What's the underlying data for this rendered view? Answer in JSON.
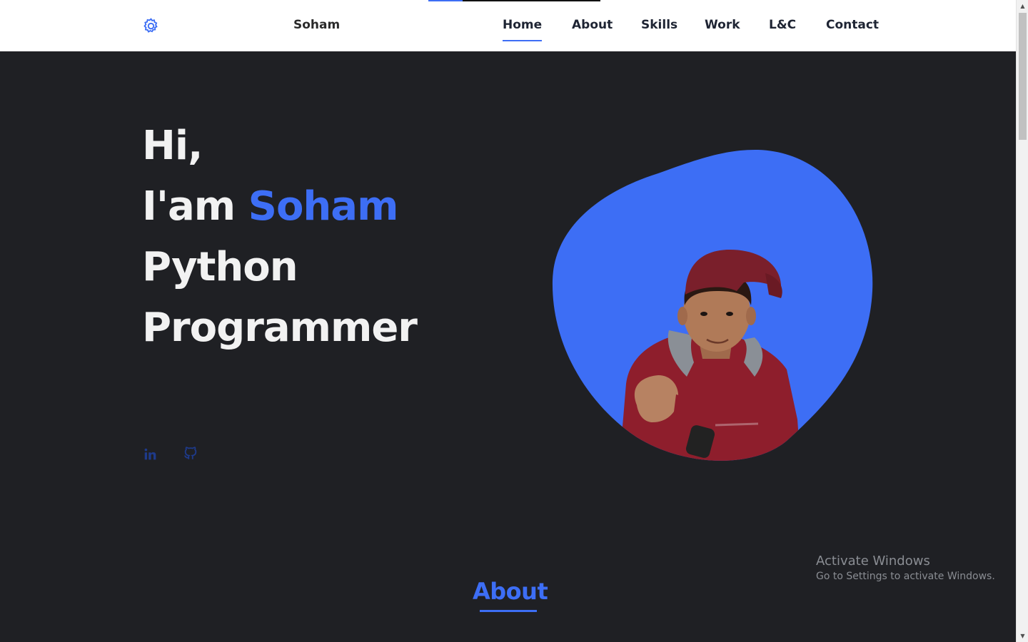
{
  "header": {
    "brand": "Soham",
    "nav": [
      {
        "label": "Home",
        "active": true
      },
      {
        "label": "About",
        "active": false
      },
      {
        "label": "Skills",
        "active": false
      },
      {
        "label": "Work",
        "active": false
      },
      {
        "label": "L&C",
        "active": false
      },
      {
        "label": "Contact",
        "active": false
      }
    ]
  },
  "hero": {
    "line1": "Hi,",
    "line2_prefix": "I'am ",
    "line2_name": "Soham",
    "line3": "Python",
    "line4": "Programmer"
  },
  "socials": [
    {
      "icon": "linkedin-icon"
    },
    {
      "icon": "github-icon"
    }
  ],
  "about": {
    "title": "About"
  },
  "watermark": {
    "line1": "Activate Windows",
    "line2": "Go to Settings to activate Windows."
  },
  "colors": {
    "accent": "#3d6ef5",
    "background": "#1f2024",
    "header_bg": "#ffffff"
  }
}
